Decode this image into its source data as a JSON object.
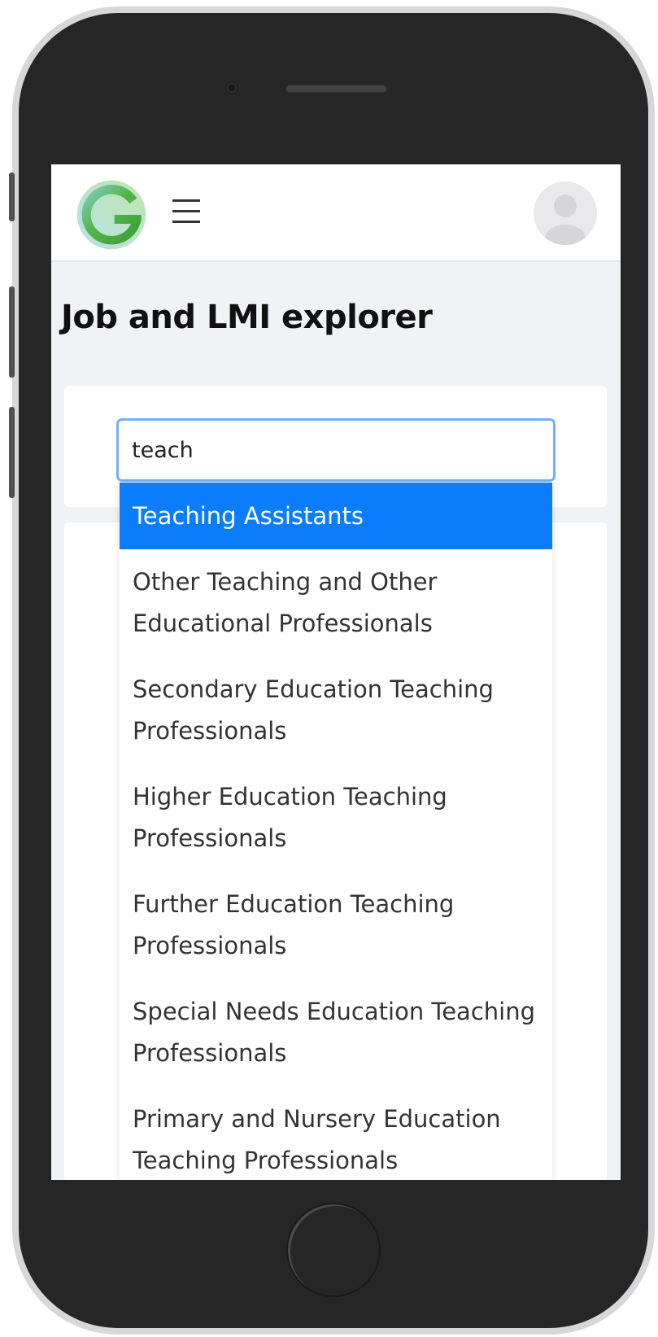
{
  "app": {
    "page_title": "Job and LMI explorer"
  },
  "header": {
    "logo_icon": "g-logo-icon",
    "menu_icon": "hamburger-menu-icon",
    "avatar_icon": "user-avatar-icon"
  },
  "search": {
    "value": "teach"
  },
  "suggestions": [
    {
      "label": "Teaching Assistants",
      "active": true
    },
    {
      "label": "Other Teaching and Other Educational Professionals",
      "active": false
    },
    {
      "label": "Secondary Education Teaching Professionals",
      "active": false
    },
    {
      "label": "Higher Education Teaching Professionals",
      "active": false
    },
    {
      "label": "Further Education Teaching Professionals",
      "active": false
    },
    {
      "label": "Special Needs Education Teaching Professionals",
      "active": false
    },
    {
      "label": "Primary and Nursery Education Teaching Professionals",
      "active": false
    }
  ],
  "colors": {
    "highlight": "#0a7dfc",
    "input_focus_border": "#78aef2",
    "screen_background": "#f0f2f6"
  }
}
